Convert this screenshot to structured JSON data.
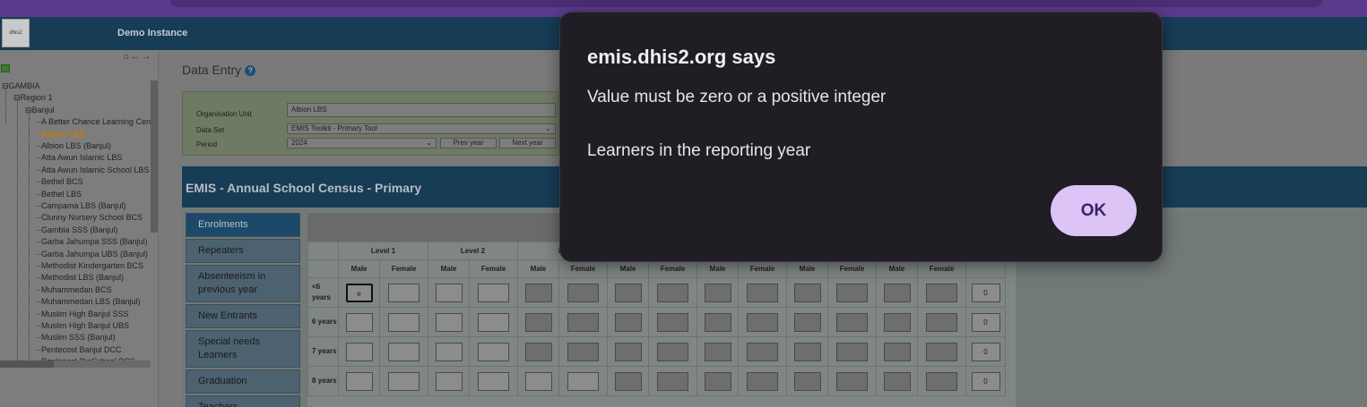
{
  "browser": {
    "accent": "#5b3a8e"
  },
  "header": {
    "instance_title": "Demo Instance",
    "logo_text": "dhis2"
  },
  "tree": {
    "nodes": [
      {
        "label": "GAMBIA"
      },
      {
        "label": "Region 1"
      },
      {
        "label": "Banjul"
      },
      {
        "label": "A Better Chance Learning Cen"
      },
      {
        "label": "Albion LBS",
        "selected": true
      },
      {
        "label": "Albion LBS (Banjul)"
      },
      {
        "label": "Atta Awun Islamic LBS"
      },
      {
        "label": "Atta Awun Islamic School LBS"
      },
      {
        "label": "Bethel BCS"
      },
      {
        "label": "Bethel LBS"
      },
      {
        "label": "Campama LBS (Banjul)"
      },
      {
        "label": "Clunny Nursery School BCS"
      },
      {
        "label": "Gambia SSS (Banjul)"
      },
      {
        "label": "Garba Jahumpa SSS (Banjul)"
      },
      {
        "label": "Garba Jahumpa UBS (Banjul)"
      },
      {
        "label": "Methodist Kindergarten BCS"
      },
      {
        "label": "Methodist LBS (Banjul)"
      },
      {
        "label": "Muhammedan BCS"
      },
      {
        "label": "Muhammedan LBS (Banjul)"
      },
      {
        "label": "Muslim High Banjul SSS"
      },
      {
        "label": "Muslim High Banjul UBS"
      },
      {
        "label": "Muslim SSS (Banjul)"
      },
      {
        "label": "Pentecost Banjul DCC"
      },
      {
        "label": "Pentecost PreSchool BCS"
      }
    ]
  },
  "main": {
    "page_title": "Data Entry",
    "help_icon": "?",
    "selection": {
      "org_unit_label": "Organisation Unit",
      "org_unit_value": "Albion LBS",
      "data_set_label": "Data Set",
      "data_set_value": "EMIS Toolkit - Primary Tool",
      "period_label": "Period",
      "period_value": "2024",
      "prev_year": "Prev year",
      "next_year": "Next year"
    },
    "census_title": "EMIS - Annual School Census - Primary",
    "tabs": [
      "Enrolments",
      "Repeaters",
      "Absenteeism in previous year",
      "New Entrants",
      "Special needs Learners",
      "Graduation",
      "Teachers"
    ],
    "grid": {
      "levels": [
        "Level 1",
        "Level 2",
        "Le"
      ],
      "sex_headers": [
        "Male",
        "Female",
        "Male",
        "Female",
        "Male",
        "Female",
        "Male",
        "Female",
        "Male",
        "Female",
        "Male",
        "Female",
        "Male",
        "Female"
      ],
      "rows": [
        {
          "label": "<6 years",
          "first_value": "e",
          "total": "0"
        },
        {
          "label": "6 years",
          "total": "0"
        },
        {
          "label": "7 years",
          "total": "0"
        },
        {
          "label": "8 years",
          "total": "0"
        }
      ]
    }
  },
  "dialog": {
    "title": "emis.dhis2.org says",
    "message": "Value must be zero or a positive integer",
    "detail": "Learners in the reporting year",
    "ok_label": "OK"
  }
}
